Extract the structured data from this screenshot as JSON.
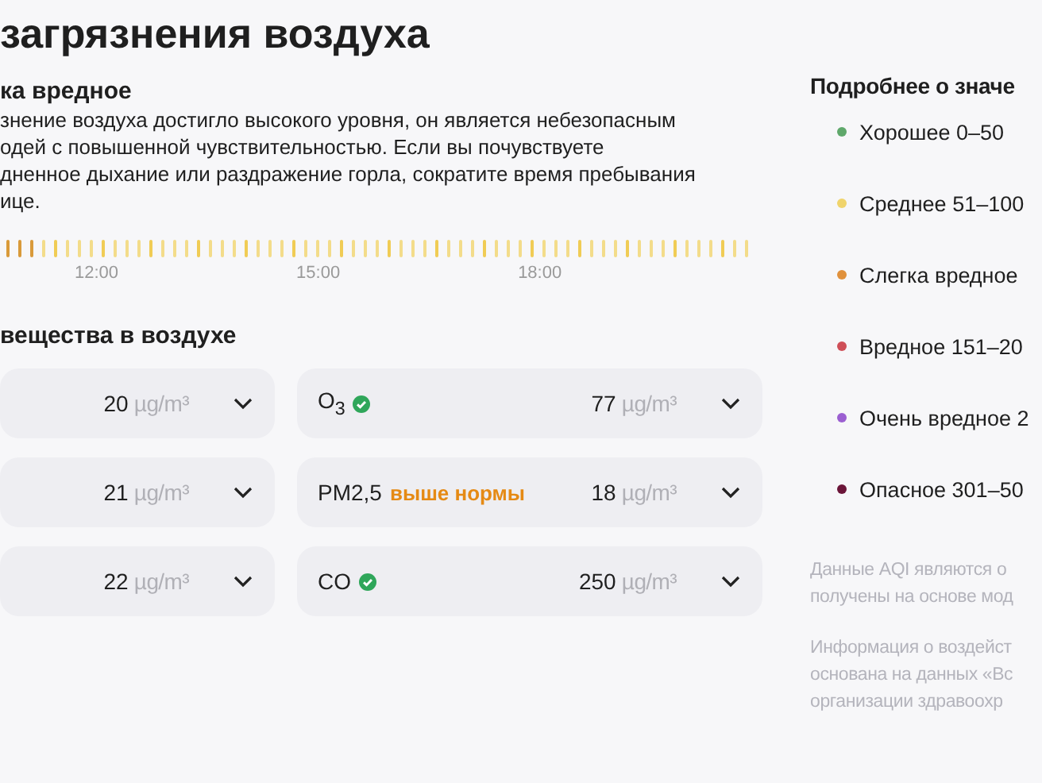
{
  "title": "загрязнения воздуха",
  "summary": {
    "heading": "ка вредное",
    "lines": [
      "знение воздуха достигло высокого уровня, он является небезопасным",
      "одей с повышенной чувствительностью. Если вы почувствуете",
      "дненное дыхание или раздражение горла, сократите время пребывания",
      "ице."
    ]
  },
  "timeline": {
    "labels": [
      "12:00",
      "15:00",
      "18:00"
    ]
  },
  "pollutants": {
    "heading": "вещества в воздухе",
    "left": [
      {
        "value": "20",
        "unit": "µg/m³"
      },
      {
        "value": "21",
        "unit": "µg/m³"
      },
      {
        "value": "22",
        "unit": "µg/m³"
      }
    ],
    "right": [
      {
        "name": "O$_{3}$",
        "normal": true,
        "value": "77",
        "unit": "µg/m³"
      },
      {
        "name": "PM2,5",
        "normal": false,
        "note": "выше нормы",
        "value": "18",
        "unit": "µg/m³"
      },
      {
        "name": "CO",
        "normal": true,
        "value": "250",
        "unit": "µg/m³"
      }
    ]
  },
  "legend": {
    "heading": "Подробнее о значе",
    "items": [
      {
        "label": "Хорошее 0–50",
        "color": "#5fa86b"
      },
      {
        "label": "Среднее 51–100",
        "color": "#f0d46c"
      },
      {
        "label": "Слегка вредное",
        "color": "#e0913c"
      },
      {
        "label": "Вредное 151–20",
        "color": "#cf4f58"
      },
      {
        "label": "Очень вредное 2",
        "color": "#9b5fd1"
      },
      {
        "label": "Опасное 301–50",
        "color": "#6b1539"
      }
    ]
  },
  "notes": [
    [
      "Данные AQI являются о",
      "получены на основе мод"
    ],
    [
      "Информация о воздейст",
      "основана на данных «Вс",
      "организации здравоохр"
    ]
  ]
}
